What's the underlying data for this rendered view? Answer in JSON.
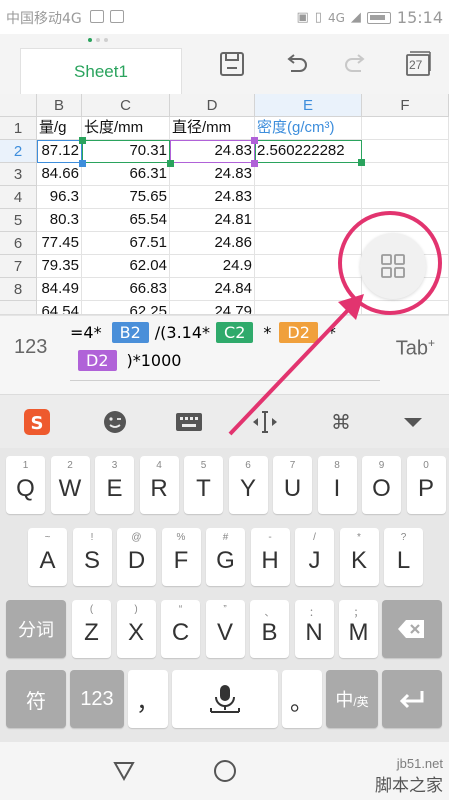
{
  "status_bar": {
    "carrier": "中国移动4G",
    "network": "4G",
    "time": "15:14"
  },
  "app": {
    "sheet_tab": "Sheet1",
    "calendar_day": "27",
    "page_indicator": {
      "pages": 3,
      "active": 0
    }
  },
  "grid": {
    "columns": [
      "B",
      "C",
      "D",
      "E",
      "F"
    ],
    "selected_column": "E",
    "rows": [
      "1",
      "2",
      "3",
      "4",
      "5",
      "6",
      "7",
      "8",
      ""
    ],
    "selected_row": "2",
    "cells": [
      [
        "量/g",
        "长度/mm",
        "直径/mm",
        "密度(g/cm³)",
        ""
      ],
      [
        "87.12",
        "70.31",
        "24.83",
        "2.560222282",
        ""
      ],
      [
        "84.66",
        "66.31",
        "24.83",
        "",
        ""
      ],
      [
        "96.3",
        "75.65",
        "24.83",
        "",
        ""
      ],
      [
        "80.3",
        "65.54",
        "24.81",
        "",
        ""
      ],
      [
        "77.45",
        "67.51",
        "24.86",
        "",
        ""
      ],
      [
        "79.35",
        "62.04",
        "24.9",
        "",
        ""
      ],
      [
        "84.49",
        "66.83",
        "24.84",
        "",
        ""
      ],
      [
        "64.54",
        "62.25",
        "24.79",
        "",
        ""
      ]
    ],
    "colors": {
      "b_ref": "#3e8edc",
      "c_ref": "#2aa35d",
      "d_ref": "#b062d8",
      "active": "#2aa35d"
    }
  },
  "formula_bar": {
    "mode_label": "123",
    "prefix": "=4*",
    "ref1": "B2",
    "part2": "/(3.14*",
    "ref2": "C2",
    "part3": "*",
    "ref3": "D2",
    "part4": "*",
    "ref4": "D2",
    "suffix": ")*1000",
    "tab_label": "Tab",
    "chip_colors": {
      "B2": "#4a8fd9",
      "C2": "#2faa6b",
      "D2_orange": "#f0a03c",
      "D2_purple": "#b062d8"
    }
  },
  "keyboard": {
    "row1": [
      {
        "main": "Q",
        "sub": "1"
      },
      {
        "main": "W",
        "sub": "2"
      },
      {
        "main": "E",
        "sub": "3"
      },
      {
        "main": "R",
        "sub": "4"
      },
      {
        "main": "T",
        "sub": "5"
      },
      {
        "main": "Y",
        "sub": "6"
      },
      {
        "main": "U",
        "sub": "7"
      },
      {
        "main": "I",
        "sub": "8"
      },
      {
        "main": "O",
        "sub": "9"
      },
      {
        "main": "P",
        "sub": "0"
      }
    ],
    "row2": [
      {
        "main": "A",
        "sub": "~"
      },
      {
        "main": "S",
        "sub": "!"
      },
      {
        "main": "D",
        "sub": "@"
      },
      {
        "main": "F",
        "sub": "%"
      },
      {
        "main": "G",
        "sub": "#"
      },
      {
        "main": "H",
        "sub": "-"
      },
      {
        "main": "J",
        "sub": "/"
      },
      {
        "main": "K",
        "sub": "*"
      },
      {
        "main": "L",
        "sub": "?"
      }
    ],
    "row3": [
      {
        "main": "Z",
        "sub": "("
      },
      {
        "main": "X",
        "sub": ")"
      },
      {
        "main": "C",
        "sub": "“"
      },
      {
        "main": "V",
        "sub": "”"
      },
      {
        "main": "B",
        "sub": "、"
      },
      {
        "main": "N",
        "sub": "："
      },
      {
        "main": "M",
        "sub": "；"
      }
    ],
    "split_label": "分词",
    "symbol_label": "符",
    "num_label": "123",
    "comma_label": "，",
    "period_label": "。",
    "lang_label": "中",
    "lang_sub": "/英"
  },
  "watermark": {
    "line1": "jb51.net",
    "line2": "脚本之家"
  }
}
